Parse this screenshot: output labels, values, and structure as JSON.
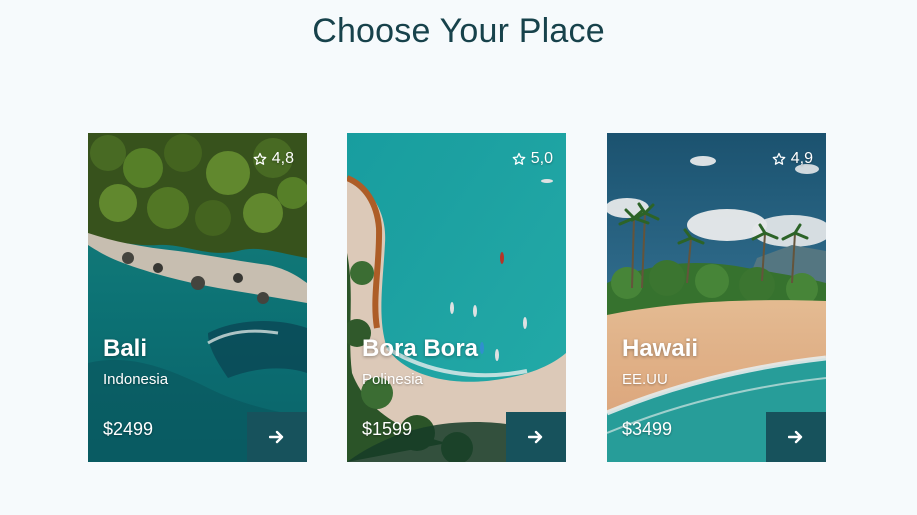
{
  "header": {
    "title": "Choose Your Place"
  },
  "cards": [
    {
      "name": "Bali",
      "location": "Indonesia",
      "price": "$2499",
      "rating": "4,8",
      "image": "aerial-forest-beach"
    },
    {
      "name": "Bora Bora",
      "location": "Polinesia",
      "price": "$1599",
      "rating": "5,0",
      "image": "aerial-lagoon-boats"
    },
    {
      "name": "Hawaii",
      "location": "EE.UU",
      "price": "$3499",
      "rating": "4,9",
      "image": "palm-beach-coast"
    }
  ],
  "icons": {
    "rating": "star-outline-icon",
    "action": "arrow-right-icon"
  },
  "colors": {
    "title": "#17424b",
    "button": "#17525c",
    "background": "#f6fafc"
  }
}
